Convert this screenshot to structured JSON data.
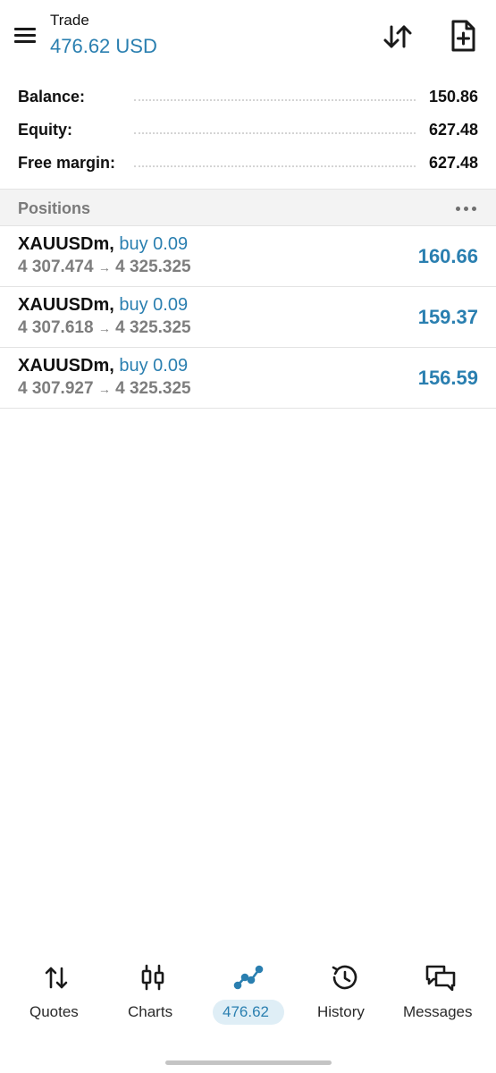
{
  "header": {
    "title": "Trade",
    "amount": "476.62 USD",
    "menu_icon": "hamburger-menu-icon",
    "sort_icon": "sort-arrows-icon",
    "new_order_icon": "new-order-document-icon"
  },
  "summary": [
    {
      "label": "Balance:",
      "value": "150.86"
    },
    {
      "label": "Equity:",
      "value": "627.48"
    },
    {
      "label": "Free margin:",
      "value": "627.48"
    }
  ],
  "positions_section": {
    "title": "Positions",
    "more_icon": "more-horizontal-icon"
  },
  "positions": [
    {
      "symbol": "XAUUSDm",
      "separator": ",",
      "side": "buy 0.09",
      "open_price": "4 307.474",
      "arrow": "→",
      "current_price": "4 325.325",
      "profit": "160.66"
    },
    {
      "symbol": "XAUUSDm",
      "separator": ",",
      "side": "buy 0.09",
      "open_price": "4 307.618",
      "arrow": "→",
      "current_price": "4 325.325",
      "profit": "159.37"
    },
    {
      "symbol": "XAUUSDm",
      "separator": ",",
      "side": "buy 0.09",
      "open_price": "4 307.927",
      "arrow": "→",
      "current_price": "4 325.325",
      "profit": "156.59"
    }
  ],
  "bottom_nav": [
    {
      "label": "Quotes",
      "icon": "quotes-arrows-icon",
      "active": false
    },
    {
      "label": "Charts",
      "icon": "candlestick-chart-icon",
      "active": false
    },
    {
      "label": "476.62",
      "icon": "trade-line-icon",
      "active": true
    },
    {
      "label": "History",
      "icon": "history-clock-icon",
      "active": false
    },
    {
      "label": "Messages",
      "icon": "chat-bubbles-icon",
      "active": false
    }
  ],
  "colors": {
    "accent": "#2a7fb0",
    "active_pill": "#dfeef6",
    "section_bg": "#f3f3f3",
    "muted_text": "#7d7d7d"
  }
}
